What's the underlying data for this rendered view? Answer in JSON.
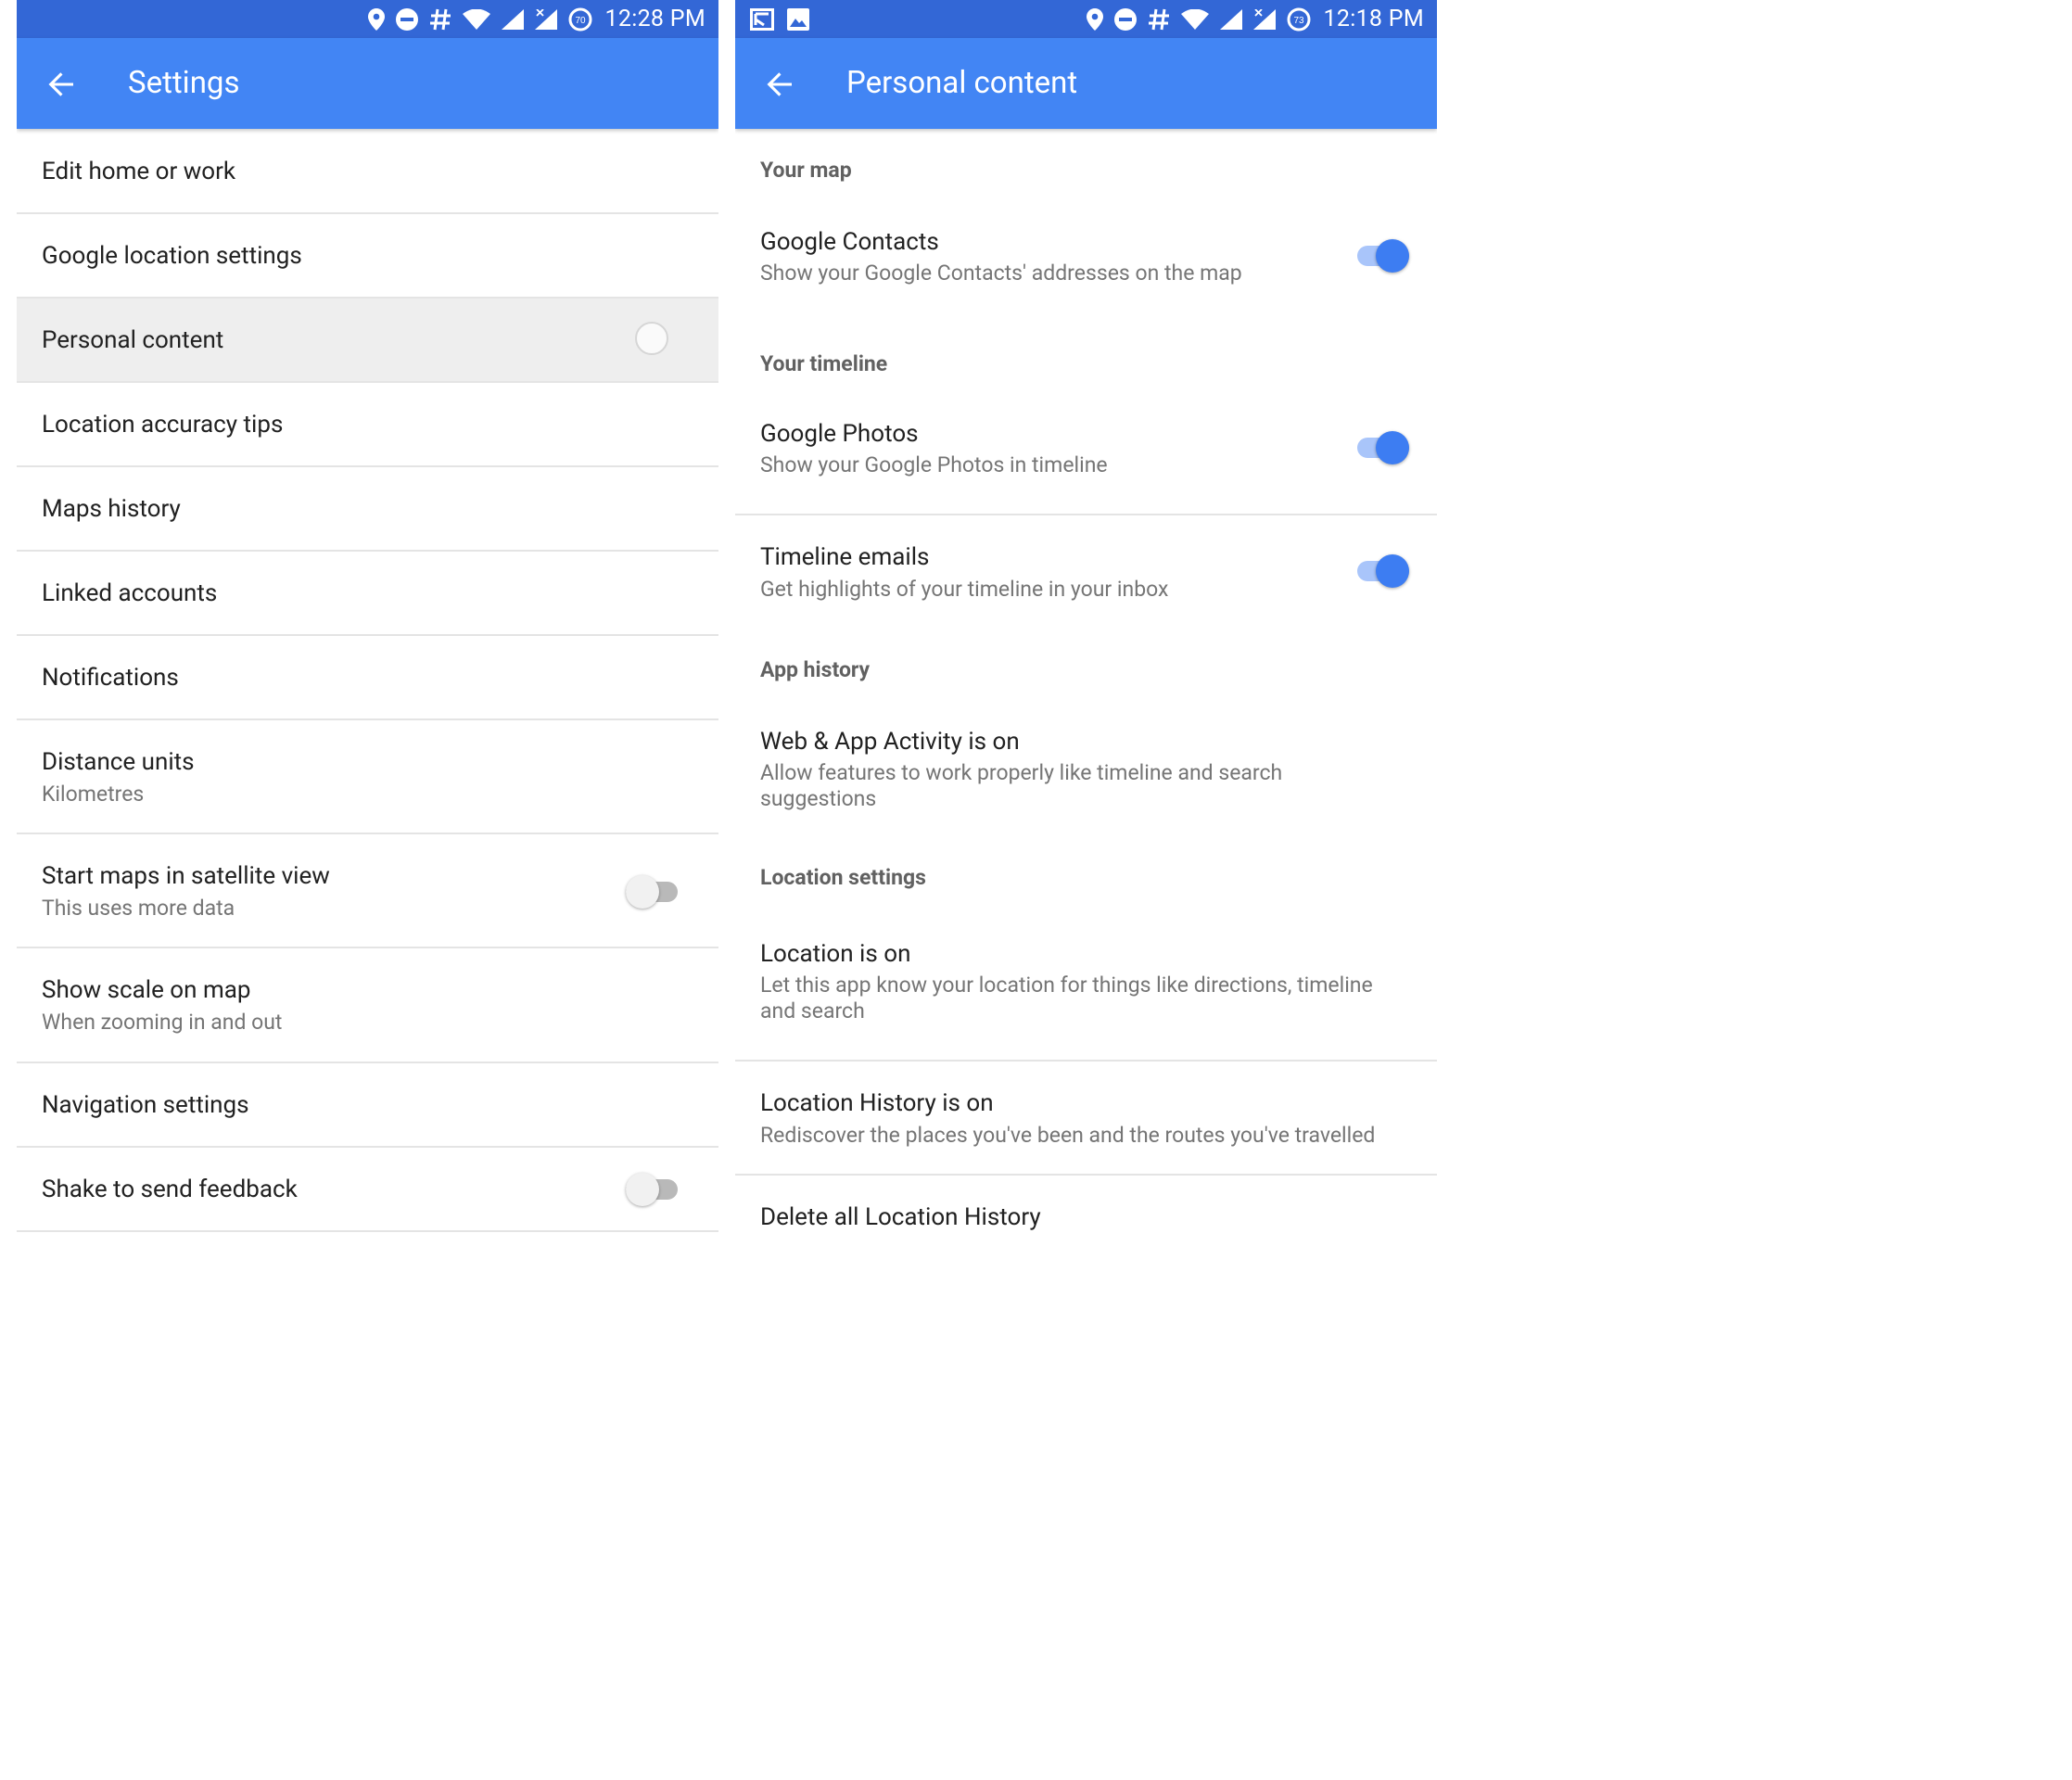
{
  "colors": {
    "status_bar": "#3367d6",
    "app_bar": "#4285f4",
    "toggle_on": "#3d7df2",
    "toggle_on_track": "#a9c5fa",
    "divider": "#e4e4e4",
    "pressed_row": "#eeeeee"
  },
  "left": {
    "status_bar": {
      "icons": [
        "location-pin-icon",
        "do-not-disturb-icon",
        "hash-icon",
        "wifi-icon",
        "signal-icon",
        "signal-no-data-icon",
        "battery-saver-icon"
      ],
      "battery_level": "70",
      "time": "12:28 PM"
    },
    "app_bar": {
      "title": "Settings",
      "back_icon": "arrow-back-icon"
    },
    "items": [
      {
        "title": "Edit home or work"
      },
      {
        "title": "Google location settings"
      },
      {
        "title": "Personal content",
        "pressed": true
      },
      {
        "title": "Location accuracy tips"
      },
      {
        "title": "Maps history"
      },
      {
        "title": "Linked accounts"
      },
      {
        "title": "Notifications"
      },
      {
        "title": "Distance units",
        "subtitle": "Kilometres"
      },
      {
        "title": "Start maps in satellite view",
        "subtitle": "This uses more data",
        "toggle": false
      },
      {
        "title": "Show scale on map",
        "subtitle": "When zooming in and out"
      },
      {
        "title": "Navigation settings"
      },
      {
        "title": "Shake to send feedback",
        "toggle": false
      }
    ]
  },
  "right": {
    "status_bar": {
      "left_icons": [
        "cast-screen-icon",
        "image-icon"
      ],
      "icons": [
        "location-pin-icon",
        "do-not-disturb-icon",
        "hash-icon",
        "wifi-icon",
        "signal-icon",
        "signal-no-data-icon",
        "battery-saver-icon"
      ],
      "battery_level": "73",
      "time": "12:18 PM"
    },
    "app_bar": {
      "title": "Personal content",
      "back_icon": "arrow-back-icon"
    },
    "sections": {
      "your_map": "Your map",
      "your_timeline": "Your timeline",
      "app_history": "App history",
      "location_settings": "Location settings"
    },
    "entries": {
      "google_contacts": {
        "title": "Google Contacts",
        "subtitle": "Show your Google Contacts' addresses on the map",
        "toggle": true
      },
      "google_photos": {
        "title": "Google Photos",
        "subtitle": "Show your Google Photos in timeline",
        "toggle": true
      },
      "timeline_emails": {
        "title": "Timeline emails",
        "subtitle": "Get highlights of your timeline in your inbox",
        "toggle": true
      },
      "web_app_activity": {
        "title": "Web & App Activity is on",
        "subtitle_line1": "Allow features to work properly like timeline and search",
        "subtitle_line2": "suggestions"
      },
      "location_on": {
        "title": "Location is on",
        "subtitle_line1": "Let this app know your location for things like directions, timeline",
        "subtitle_line2": "and search"
      },
      "location_history": {
        "title": "Location History is on",
        "subtitle": "Rediscover the places you've been and the routes you've travelled"
      },
      "delete_history": {
        "title": "Delete all Location History"
      }
    }
  }
}
